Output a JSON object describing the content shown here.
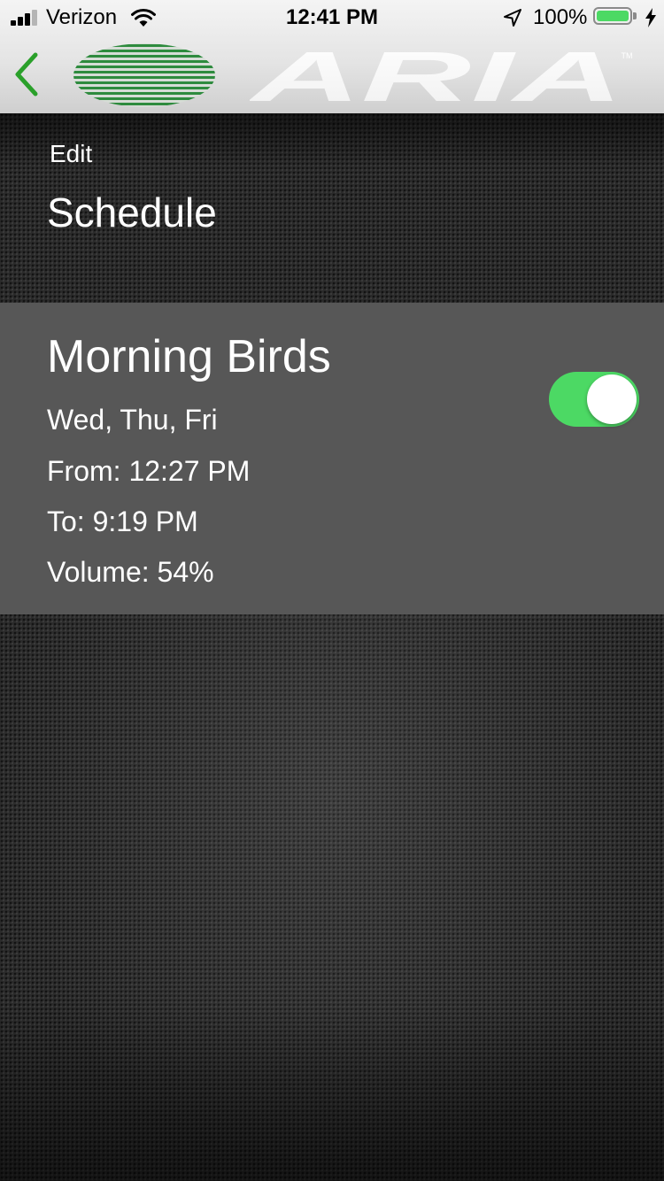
{
  "status_bar": {
    "carrier": "Verizon",
    "time": "12:41 PM",
    "battery_percent": "100%",
    "battery_level": 1.0,
    "battery_color": "#4cd964",
    "signal_bars": 3,
    "signal_bars_total": 4
  },
  "nav": {
    "back_icon": "chevron-left-icon",
    "accent_color": "#2aa02a",
    "logo_text": "ARIA",
    "logo_trademark": "TM"
  },
  "header": {
    "edit_label": "Edit",
    "title": "Schedule"
  },
  "schedules": [
    {
      "name": "Morning Birds",
      "days": "Wed, Thu, Fri",
      "from": "From: 12:27 PM",
      "to": "To: 9:19 PM",
      "volume": "Volume: 54%",
      "enabled": true,
      "toggle_color": "#4cd964"
    }
  ]
}
